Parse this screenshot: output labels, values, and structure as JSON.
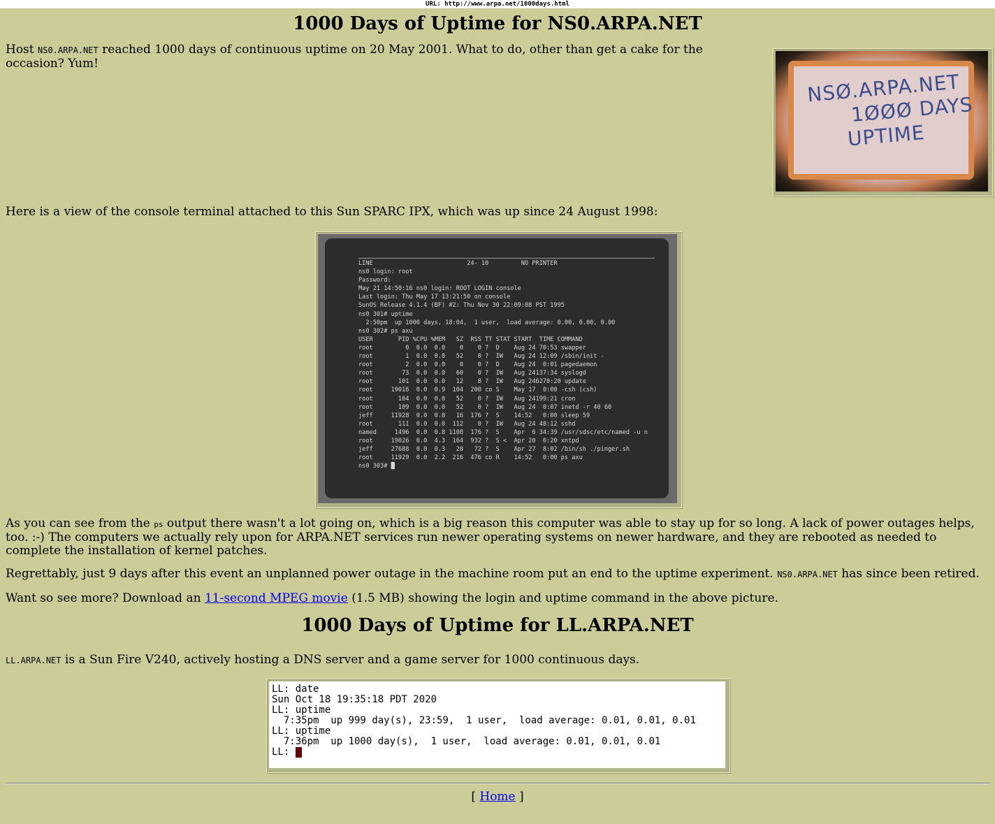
{
  "urlbar": {
    "text": "URL: http://www.arpa.net/1000days.html"
  },
  "section1": {
    "title": "1000 Days of Uptime for NS0.ARPA.NET",
    "intro_host_pre": "Host ",
    "intro_host": "NS0.ARPA.NET",
    "intro_text": " reached 1000 days of continuous uptime on 20 May 2001. What to do, other than get a cake for the occasion? Yum!",
    "cake_text": [
      "NSØ.ARPA.NET",
      "1ØØØ DAYS",
      "UPTIME"
    ],
    "console_intro": "Here is a view of the console terminal attached to this Sun SPARC IPX, which was up since 24 August 1998:",
    "console_text": "LINE                          24- 10         NO PRINTER\nns0 login: root\nPassword:\nMay 21 14:50:16 ns0 login: ROOT LOGIN console\nLast login: Thu May 17 13:21:50 on console\nSunOS Release 4.1.4 (BF) #2: Thu Nov 30 22:09:08 PST 1995\nns0 301# uptime\n  2:50pm  up 1000 days, 18:04,  1 user,  load average: 0.00, 0.00, 0.00\nns0 302# ps axu\nUSER       PID %CPU %MEM   SZ  RSS TT STAT START  TIME COMMAND\nroot         0  0.0  0.0    0    0 ?  D    Aug 24 70:53 swapper\nroot         1  0.0  0.0   52    0 ?  IW   Aug 24 12:09 /sbin/init -\nroot         2  0.0  0.0    0    0 ?  D    Aug 24  0:01 pagedaemon\nroot        73  0.0  0.0   60    0 ?  IW   Aug 24137:34 syslogd\nroot       101  0.0  0.0   12    8 ?  IW   Aug 246270:20 update\nroot     19016  0.0  0.9  104  200 co S    May 17  0:00 -csh (csh)\nroot       104  0.0  0.0   52    0 ?  IW   Aug 24199:21 cron\nroot       109  0.0  0.0   52    0 ?  IW   Aug 24  0:07 inetd -r 40 60\njeff     11928  0.0  0.8   16  176 ?  S    14:52   0:00 sleep 59\nroot       111  0.0  0.0  112    0 ?  IW   Aug 24 48:12 sshd\nnamed     1496  0.0  0.8 1108  176 ?  S    Apr  6 34:39 /usr/sdsc/etc/named -u n\nroot     19026  0.0  4.3  164  932 ?  S <  Apr 20  0:20 xntpd\njeff     27688  0.0  0.3   28   72 ?  S    Apr 27  8:02 /bin/sh ./pinger.sh\nroot     11929  0.0  2.2  216  476 co R    14:52   0:00 ps axu\nns0 303# █",
    "ps_para_pre": "As you can see from the ",
    "ps_word": "ps",
    "ps_para_post": " output there wasn't a lot going on, which is a big reason this computer was able to stay up for so long. A lack of power outages helps, too. :-) The computers we actually rely upon for ARPA.NET services run newer operating systems on newer hardware, and they are rebooted as needed to complete the installation of kernel patches.",
    "regret_pre": "Regrettably, just 9 days after this event an unplanned power outage in the machine room put an end to the uptime experiment. ",
    "regret_host": "NS0.ARPA.NET",
    "regret_post": " has since been retired.",
    "movie_pre": "Want so see more? Download an ",
    "movie_link": "11-second MPEG movie",
    "movie_post": " (1.5 MB) showing the login and uptime command in the above picture."
  },
  "section2": {
    "title": "1000 Days of Uptime for LL.ARPA.NET",
    "host": "LL.ARPA.NET",
    "desc": " is a Sun Fire V240, actively hosting a DNS server and a game server for 1000 continuous days.",
    "terminal_text": "LL: date\nSun Oct 18 19:35:18 PDT 2020\nLL: uptime\n  7:35pm  up 999 day(s), 23:59,  1 user,  load average: 0.01, 0.01, 0.01\nLL: uptime\n  7:36pm  up 1000 day(s),  1 user,  load average: 0.01, 0.01, 0.01",
    "prompt": "LL: "
  },
  "footer": {
    "left_bracket": "[ ",
    "home_link": "Home",
    "right_bracket": " ]"
  }
}
